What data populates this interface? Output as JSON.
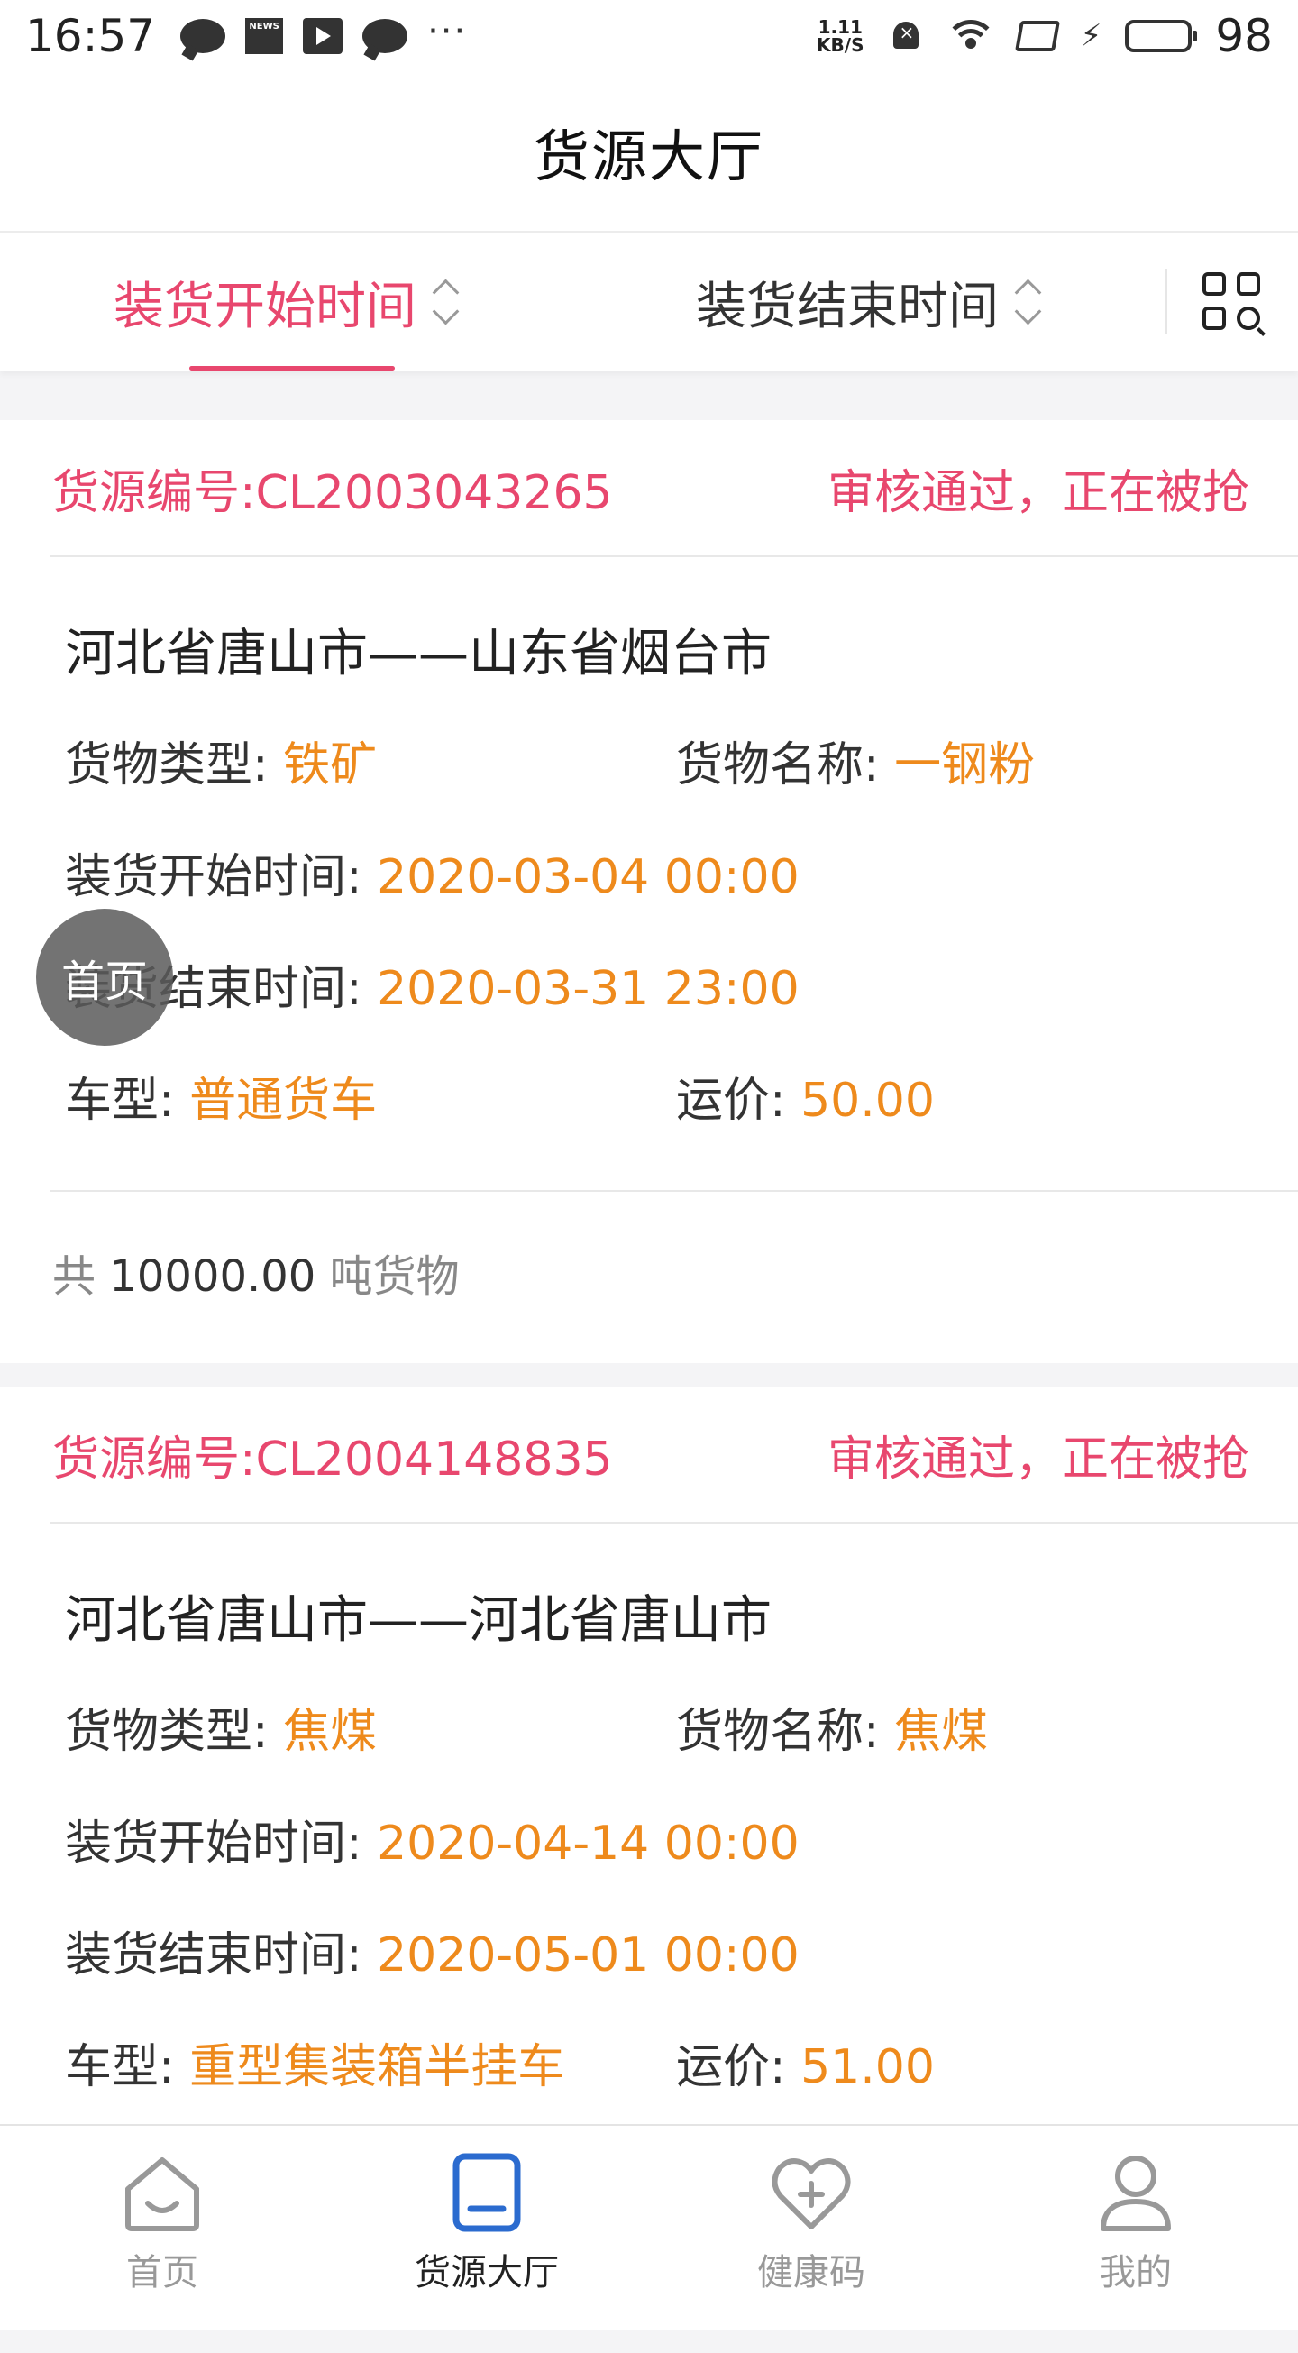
{
  "statusbar": {
    "time": "16:57",
    "news_label": "NEWS",
    "dots": "···",
    "net_speed_value": "1.11",
    "net_speed_unit": "KB/S",
    "battery_level": "98",
    "battery_percent": 98,
    "icons": [
      "chat-icon",
      "news-icon",
      "play-icon",
      "chat-icon",
      "more-dots-icon",
      "mute-bell-icon",
      "wifi-icon",
      "rotate-icon",
      "charging-icon",
      "battery-icon"
    ]
  },
  "header": {
    "title": "货源大厅"
  },
  "sortbar": {
    "tabs": [
      {
        "label": "装货开始时间",
        "active": true
      },
      {
        "label": "装货结束时间",
        "active": false
      }
    ],
    "filter_icon": "grid-search-icon"
  },
  "floating_button": {
    "label": "首页"
  },
  "colors": {
    "accent": "#e8476e",
    "value": "#ee8a1c",
    "text": "#333333",
    "muted": "#888888"
  },
  "cards": [
    {
      "id_label": "货源编号:CL2003043265",
      "status": "审核通过，正在被抢",
      "route": "河北省唐山市——山东省烟台市",
      "cargo_type_label": "货物类型:",
      "cargo_type": "铁矿",
      "cargo_name_label": "货物名称:",
      "cargo_name": "一钢粉",
      "load_start_label": "装货开始时间:",
      "load_start": "2020-03-04 00:00",
      "load_end_label": "装货结束时间:",
      "load_end": "2020-03-31 23:00",
      "vehicle_label": "车型:",
      "vehicle": "普通货车",
      "price_label": "运价:",
      "price": "50.00",
      "total_prefix": "共",
      "total_amount": "10000.00",
      "total_suffix": "吨货物"
    },
    {
      "id_label": "货源编号:CL2004148835",
      "status": "审核通过，正在被抢",
      "route": "河北省唐山市——河北省唐山市",
      "cargo_type_label": "货物类型:",
      "cargo_type": "焦煤",
      "cargo_name_label": "货物名称:",
      "cargo_name": "焦煤",
      "load_start_label": "装货开始时间:",
      "load_start": "2020-04-14 00:00",
      "load_end_label": "装货结束时间:",
      "load_end": "2020-05-01 00:00",
      "vehicle_label": "车型:",
      "vehicle": "重型集装箱半挂车",
      "price_label": "运价:",
      "price": "51.00"
    }
  ],
  "tabbar": {
    "items": [
      {
        "label": "首页",
        "icon": "home-icon",
        "active": false
      },
      {
        "label": "货源大厅",
        "icon": "document-icon",
        "active": true
      },
      {
        "label": "健康码",
        "icon": "heart-plus-icon",
        "active": false
      },
      {
        "label": "我的",
        "icon": "user-icon",
        "active": false
      }
    ]
  }
}
